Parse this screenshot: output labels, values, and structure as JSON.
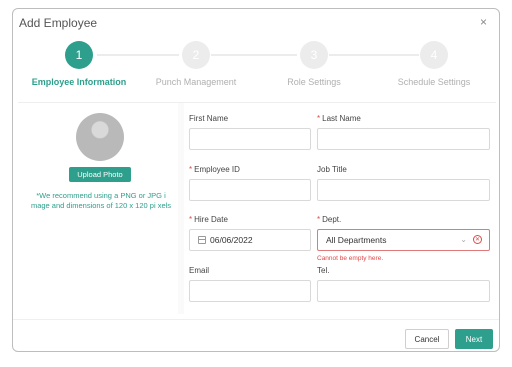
{
  "dialog": {
    "title": "Add Employee",
    "close_label": "×"
  },
  "steps": [
    {
      "number": "1",
      "label": "Employee Information",
      "active": true
    },
    {
      "number": "2",
      "label": "Punch Management",
      "active": false
    },
    {
      "number": "3",
      "label": "Role Settings",
      "active": false
    },
    {
      "number": "4",
      "label": "Schedule Settings",
      "active": false
    }
  ],
  "photo": {
    "upload_label": "Upload Photo",
    "hint": "*We recommend using a PNG or JPG i mage and dimensions of 120 x 120 pi xels"
  },
  "form": {
    "first_name": {
      "label": "First Name",
      "required": false,
      "value": ""
    },
    "last_name": {
      "label": "Last Name",
      "required": true,
      "value": ""
    },
    "employee_id": {
      "label": "Employee ID",
      "required": true,
      "value": ""
    },
    "job_title": {
      "label": "Job Title",
      "required": false,
      "value": ""
    },
    "hire_date": {
      "label": "Hire Date",
      "required": true,
      "value": "06/06/2022"
    },
    "dept": {
      "label": "Dept.",
      "required": true,
      "value": "All Departments",
      "error": "Cannot be empty here."
    },
    "email": {
      "label": "Email",
      "required": false,
      "value": ""
    },
    "tel": {
      "label": "Tel.",
      "required": false,
      "value": ""
    }
  },
  "footer": {
    "cancel_label": "Cancel",
    "next_label": "Next"
  },
  "colors": {
    "accent": "#2d9f8c",
    "error": "#e04848"
  }
}
